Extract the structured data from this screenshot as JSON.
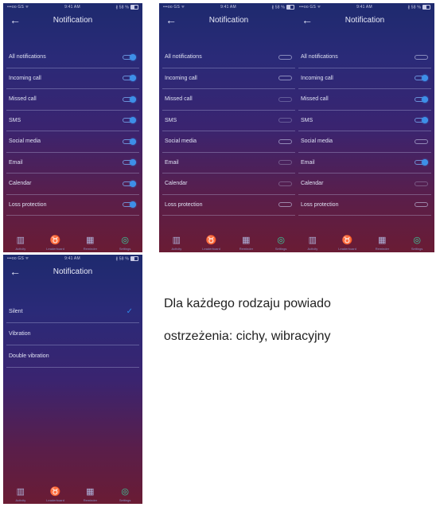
{
  "screens": [
    {
      "status": {
        "left": "•••oo GS ᯤ",
        "time": "9:41 AM",
        "right": "∦ 58 %"
      },
      "title": "Notification",
      "rows": [
        {
          "label": "All notifications",
          "state": "on"
        },
        {
          "label": "Incoming call",
          "state": "on"
        },
        {
          "label": "Missed call",
          "state": "on"
        },
        {
          "label": "SMS",
          "state": "on"
        },
        {
          "label": "Social media",
          "state": "on"
        },
        {
          "label": "Email",
          "state": "on"
        },
        {
          "label": "Calendar",
          "state": "on"
        },
        {
          "label": "Loss protection",
          "state": "on"
        }
      ],
      "tabs": [
        "Activity",
        "Leaderboard",
        "Reminder",
        "Settings"
      ]
    },
    {
      "status": {
        "left": "•••oo GS ᯤ",
        "time": "9:41 AM",
        "right": "∦ 58 %"
      },
      "title": "Notification",
      "rows": [
        {
          "label": "All notifications",
          "state": "off"
        },
        {
          "label": "Incoming call",
          "state": "off"
        },
        {
          "label": "Missed call",
          "state": "dim"
        },
        {
          "label": "SMS",
          "state": "dim"
        },
        {
          "label": "Social media",
          "state": "off"
        },
        {
          "label": "Email",
          "state": "dim"
        },
        {
          "label": "Calendar",
          "state": "dim"
        },
        {
          "label": "Loss protection",
          "state": "off"
        }
      ],
      "tabs": [
        "Activity",
        "Leaderboard",
        "Reminder",
        "Settings"
      ]
    },
    {
      "status": {
        "left": "•••oo GS ᯤ",
        "time": "9:41 AM",
        "right": "∦ 58 %"
      },
      "title": "Notification",
      "rows": [
        {
          "label": "All notifications",
          "state": "off"
        },
        {
          "label": "Incoming call",
          "state": "on"
        },
        {
          "label": "Missed call",
          "state": "on"
        },
        {
          "label": "SMS",
          "state": "on"
        },
        {
          "label": "Social media",
          "state": "off"
        },
        {
          "label": "Email",
          "state": "on"
        },
        {
          "label": "Calendar",
          "state": "dim"
        },
        {
          "label": "Loss protection",
          "state": "off"
        }
      ],
      "tabs": [
        "Activity",
        "Leaderboard",
        "Reminder",
        "Settings"
      ]
    },
    {
      "status": {
        "left": "•••oo GS ᯤ",
        "time": "9:41 AM",
        "right": "∦ 58 %"
      },
      "title": "Notification",
      "options": [
        {
          "label": "Silent",
          "checked": true
        },
        {
          "label": "Vibration",
          "checked": false
        },
        {
          "label": "Double vibration",
          "checked": false
        }
      ],
      "tabs": [
        "Activity",
        "Leaderboard",
        "Reminder",
        "Settings"
      ]
    }
  ],
  "caption": {
    "line1": "Dla każdego rodzaju powiado",
    "line2": "ostrzeżenia: cichy, wibracyjny"
  },
  "icons": {
    "back": "arrow-left-icon",
    "tabs": [
      "bar-chart-icon",
      "medal-icon",
      "calendar-icon",
      "settings-gear-icon"
    ],
    "check": "checkmark-icon"
  },
  "colors": {
    "toggle_on": "#3d8fe8",
    "active_tab": "#37d3a0",
    "check": "#2f86e6"
  }
}
